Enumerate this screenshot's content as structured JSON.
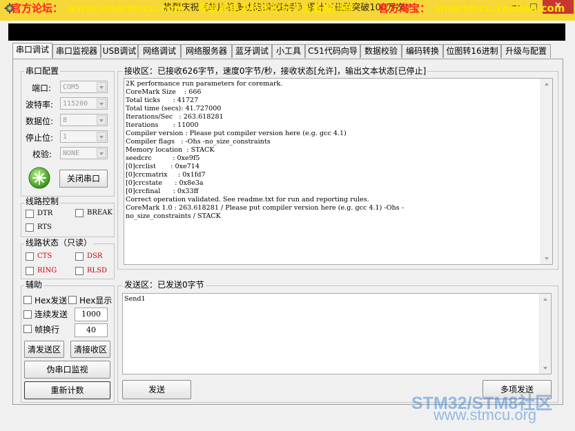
{
  "window": {
    "title": "热烈庆祝《单片机多功能调试助手》累计下载量突破100万次!!",
    "minimize": "—",
    "maximize": "□",
    "close": "✕"
  },
  "banner": {
    "forum_label": "官方论坛：",
    "forum_url": "www.smartmcu.com",
    "slogan": "专业的电子技术论坛与设备提供商",
    "shop_label": "官方淘宝：",
    "shop_url": "smartmcu.taobao.com"
  },
  "tabs": [
    "串口调试",
    "串口监视器",
    "USB调试",
    "网络调试",
    "网络服务器",
    "蓝牙调试",
    "小工具",
    "C51代码向导",
    "数据校验",
    "编码转换",
    "位图转16进制",
    "升级与配置"
  ],
  "serial_config": {
    "title": "串口配置",
    "port": {
      "label": "端口:",
      "value": "COM5"
    },
    "baud": {
      "label": "波特率:",
      "value": "115200"
    },
    "databits": {
      "label": "数据位:",
      "value": "8"
    },
    "stopbits": {
      "label": "停止位:",
      "value": "1"
    },
    "parity": {
      "label": "校验:",
      "value": "NONE"
    },
    "close_button": "关闭串口"
  },
  "line_control": {
    "title": "线路控制",
    "dtr": "DTR",
    "brk": "BREAK",
    "rts": "RTS"
  },
  "line_status": {
    "title": "线路状态（只读）",
    "cts": "CTS",
    "dsr": "DSR",
    "ring": "RING",
    "rlsd": "RLSD"
  },
  "assist": {
    "title": "辅助",
    "hex_send": "Hex发送",
    "hex_show": "Hex显示",
    "continuous_send": "连续发送",
    "continuous_value": "1000",
    "frame_newline": "帧换行",
    "frame_value": "40",
    "clear_send": "清发送区",
    "clear_recv": "清接收区",
    "monitor": "伪串口监视",
    "recount": "重新计数"
  },
  "receive": {
    "title": "接收区：已接收626字节，速度0字节/秒，接收状态[允许]，输出文本状态[已停止]",
    "lines": [
      "2K performance run parameters for coremark.",
      "CoreMark Size    : 666",
      "Total ticks      : 41727",
      "Total time (secs): 41.727000",
      "Iterations/Sec   : 263.618281",
      "Iterations       : 11000",
      "Compiler version : Please put compiler version here (e.g. gcc 4.1)",
      "Compiler flags   : -Ohs -no_size_constraints",
      "Memory location  : STACK",
      "seedcrc          : 0xe9f5",
      "[0]crclist       : 0xe714",
      "[0]crcmatrix     : 0x1fd7",
      "[0]crcstate      : 0x8e3a",
      "[0]crcfinal      : 0x33ff",
      "Correct operation validated. See readme.txt for run and reporting rules.",
      "CoreMark 1.0 : 263.618281 / Please put compiler version here (e.g. gcc 4.1) -Ohs -",
      "no_size_constraints / STACK"
    ]
  },
  "send": {
    "title": "发送区：已发送0字节",
    "content": "Send1",
    "send_button": "发送",
    "multi_send_button": "多项发送"
  },
  "watermark": {
    "line1": "STM32/STM8社区",
    "line2": "www.stmcu.org"
  }
}
